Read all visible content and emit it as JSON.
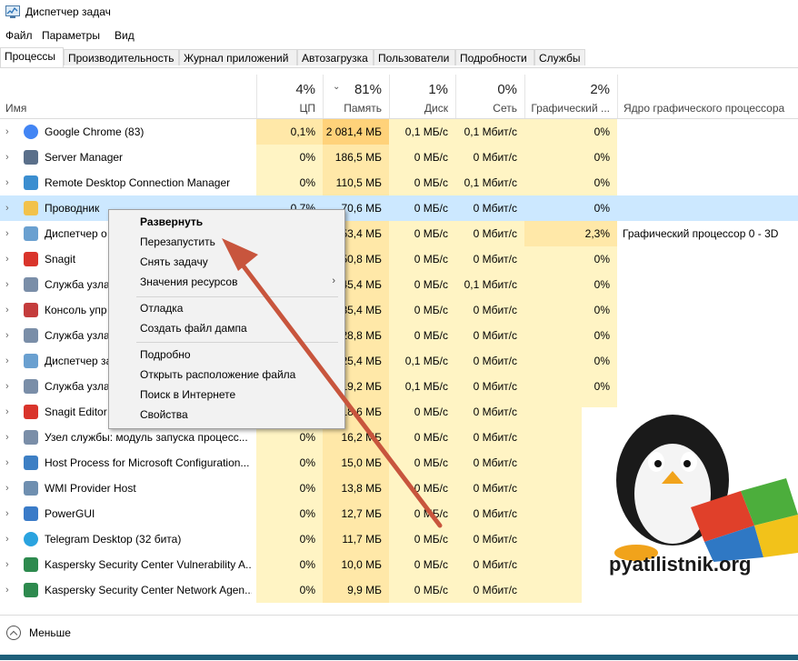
{
  "window": {
    "title": "Диспетчер задач",
    "app_icon": "task-manager-icon"
  },
  "menu": [
    "Файл",
    "Параметры",
    "Вид"
  ],
  "tabs": [
    "Процессы",
    "Производительность",
    "Журнал приложений",
    "Автозагрузка",
    "Пользователи",
    "Подробности",
    "Службы"
  ],
  "active_tab": "Процессы",
  "columns": {
    "name": {
      "label": "Имя"
    },
    "cpu": {
      "pct": "4%",
      "label": "ЦП"
    },
    "memory": {
      "pct": "81%",
      "label": "Память",
      "sort": "chevron-down-icon"
    },
    "disk": {
      "pct": "1%",
      "label": "Диск"
    },
    "network": {
      "pct": "0%",
      "label": "Сеть"
    },
    "gpu": {
      "pct": "2%",
      "label": "Графический ..."
    },
    "gpu_engine": {
      "label": "Ядро графического процессора"
    }
  },
  "processes": [
    {
      "name": "Google Chrome (83)",
      "icon": "chrome-icon",
      "cpu": "0,1%",
      "memory": "2 081,4 МБ",
      "disk": "0,1 МБ/с",
      "network": "0,1 Мбит/с",
      "gpu": "0%",
      "gpu_engine": ""
    },
    {
      "name": "Server Manager",
      "icon": "server-manager-icon",
      "cpu": "0%",
      "memory": "186,5 МБ",
      "disk": "0 МБ/с",
      "network": "0 Мбит/с",
      "gpu": "0%",
      "gpu_engine": ""
    },
    {
      "name": "Remote Desktop Connection Manager",
      "icon": "remote-desktop-icon",
      "cpu": "0%",
      "memory": "110,5 МБ",
      "disk": "0 МБ/с",
      "network": "0,1 Мбит/с",
      "gpu": "0%",
      "gpu_engine": ""
    },
    {
      "name": "Проводник",
      "icon": "explorer-folder-icon",
      "cpu": "0,7%",
      "memory": "70,6 МБ",
      "disk": "0 МБ/с",
      "network": "0 Мбит/с",
      "gpu": "0%",
      "gpu_engine": ""
    },
    {
      "name": "Диспетчер о",
      "icon": "task-manager-icon",
      "cpu": "",
      "memory": "53,4 МБ",
      "disk": "0 МБ/с",
      "network": "0 Мбит/с",
      "gpu": "2,3%",
      "gpu_engine": "Графический процессор 0 - 3D"
    },
    {
      "name": "Snagit",
      "icon": "snagit-icon",
      "cpu": "",
      "memory": "50,8 МБ",
      "disk": "0 МБ/с",
      "network": "0 Мбит/с",
      "gpu": "0%",
      "gpu_engine": ""
    },
    {
      "name": "Служба узла",
      "icon": "service-gear-icon",
      "cpu": "",
      "memory": "45,4 МБ",
      "disk": "0 МБ/с",
      "network": "0,1 Мбит/с",
      "gpu": "0%",
      "gpu_engine": ""
    },
    {
      "name": "Консоль упр",
      "icon": "console-icon",
      "cpu": "",
      "memory": "35,4 МБ",
      "disk": "0 МБ/с",
      "network": "0 Мбит/с",
      "gpu": "0%",
      "gpu_engine": ""
    },
    {
      "name": "Служба узла",
      "icon": "service-gear-icon",
      "cpu": "",
      "memory": "28,8 МБ",
      "disk": "0 МБ/с",
      "network": "0 Мбит/с",
      "gpu": "0%",
      "gpu_engine": ""
    },
    {
      "name": "Диспетчер за",
      "icon": "task-manager-icon",
      "cpu": "",
      "memory": "25,4 МБ",
      "disk": "0,1 МБ/с",
      "network": "0 Мбит/с",
      "gpu": "0%",
      "gpu_engine": ""
    },
    {
      "name": "Служба узла",
      "icon": "service-gear-icon",
      "cpu": "",
      "memory": "19,2 МБ",
      "disk": "0,1 МБ/с",
      "network": "0 Мбит/с",
      "gpu": "0%",
      "gpu_engine": ""
    },
    {
      "name": "Snagit Editor",
      "icon": "snagit-icon",
      "cpu": "",
      "memory": "18,6 МБ",
      "disk": "0 МБ/с",
      "network": "0 Мбит/с",
      "gpu": "",
      "gpu_engine": ""
    },
    {
      "name": "Узел службы: модуль запуска процесс...",
      "icon": "service-gear-icon",
      "cpu": "0%",
      "memory": "16,2 МБ",
      "disk": "0 МБ/с",
      "network": "0 Мбит/с",
      "gpu": "",
      "gpu_engine": ""
    },
    {
      "name": "Host Process for Microsoft Configuration...",
      "icon": "host-process-icon",
      "cpu": "0%",
      "memory": "15,0 МБ",
      "disk": "0 МБ/с",
      "network": "0 Мбит/с",
      "gpu": "",
      "gpu_engine": ""
    },
    {
      "name": "WMI Provider Host",
      "icon": "wmi-icon",
      "cpu": "0%",
      "memory": "13,8 МБ",
      "disk": "0 МБ/с",
      "network": "0 Мбит/с",
      "gpu": "",
      "gpu_engine": ""
    },
    {
      "name": "PowerGUI",
      "icon": "powergui-icon",
      "cpu": "0%",
      "memory": "12,7 МБ",
      "disk": "0 МБ/с",
      "network": "0 Мбит/с",
      "gpu": "",
      "gpu_engine": ""
    },
    {
      "name": "Telegram Desktop (32 бита)",
      "icon": "telegram-icon",
      "cpu": "0%",
      "memory": "11,7 МБ",
      "disk": "0 МБ/с",
      "network": "0 Мбит/с",
      "gpu": "",
      "gpu_engine": ""
    },
    {
      "name": "Kaspersky Security Center Vulnerability A...",
      "icon": "kaspersky-icon",
      "cpu": "0%",
      "memory": "10,0 МБ",
      "disk": "0 МБ/с",
      "network": "0 Мбит/с",
      "gpu": "",
      "gpu_engine": ""
    },
    {
      "name": "Kaspersky Security Center Network Agen...",
      "icon": "kaspersky-icon",
      "cpu": "0%",
      "memory": "9,9 МБ",
      "disk": "0 МБ/с",
      "network": "0 Мбит/с",
      "gpu": "",
      "gpu_engine": ""
    }
  ],
  "context_menu": {
    "items": [
      {
        "label": "Развернуть",
        "bold": true
      },
      {
        "label": "Перезапустить"
      },
      {
        "label": "Снять задачу"
      },
      {
        "label": "Значения ресурсов",
        "submenu": true
      },
      {
        "label": "Отладка"
      },
      {
        "label": "Создать файл дампа"
      },
      {
        "label": "Подробно"
      },
      {
        "label": "Открыть расположение файла"
      },
      {
        "label": "Поиск в Интернете"
      },
      {
        "label": "Свойства"
      }
    ]
  },
  "footer": {
    "label": "Меньше"
  },
  "watermark": {
    "text": "pyatilistnik.org"
  },
  "colors": {
    "selected_row": "#cce8ff",
    "heat_light": "#fff4c4",
    "heat_medium": "#ffe8a8",
    "heat_strong": "#ffd27a",
    "arrow": "#c8553d"
  }
}
